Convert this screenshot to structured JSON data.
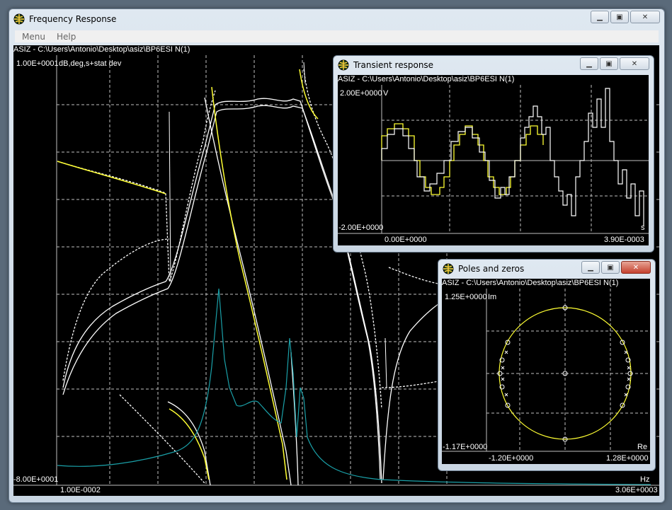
{
  "colors": {
    "plot_bg": "#000000",
    "grid": "#ffffff",
    "trace_white": "#ffffff",
    "trace_yellow": "#ffff33",
    "trace_teal": "#1aa0a8"
  },
  "main": {
    "title": "Frequency Response",
    "menu": [
      {
        "label": "Menu"
      },
      {
        "label": "Help"
      }
    ],
    "path": "ASIZ - C:\\Users\\Antonio\\Desktop\\asiz\\BP6ESI N(1)",
    "units": "dB,deg,s+stat dev",
    "ymax": "1.00E+0001",
    "ymin": "-8.00E+0001",
    "xmin": "1.00E-0002",
    "xmax": "3.06E+0003",
    "xunit": "Hz"
  },
  "transient": {
    "title": "Transient response",
    "path": "ASIZ - C:\\Users\\Antonio\\Desktop\\asiz\\BP6ESI N(1)",
    "ymax": "2.00E+0000",
    "yunit": "V",
    "ymin": "-2.00E+0000",
    "xmin": "0.00E+0000",
    "xmax": "3.90E-0003",
    "xunit": "s"
  },
  "poles": {
    "title": "Poles and zeros",
    "path": "ASIZ - C:\\Users\\Antonio\\Desktop\\asiz\\BP6ESI N(1)",
    "ymax": "1.25E+0000",
    "yunit": "Im",
    "ymin": "-1.17E+0000",
    "xmin": "-1.20E+0000",
    "xmax": "1.28E+0000",
    "xunit": "Re"
  }
}
